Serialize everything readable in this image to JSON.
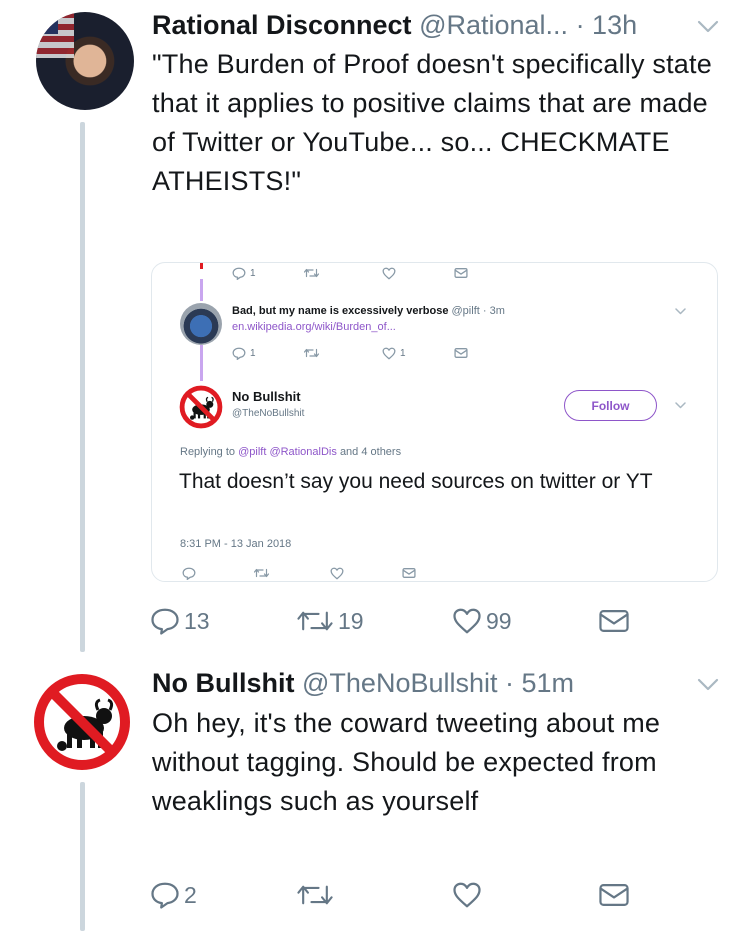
{
  "tweet1": {
    "name": "Rational Disconnect",
    "handle": "@Rational...",
    "time": "· 13h",
    "text": "\"The Burden of Proof doesn't specifically state that it applies to positive claims that are made of Twitter or YouTube... so... CHECKMATE ATHEISTS!\"",
    "replies": "13",
    "retweets": "19",
    "likes": "99"
  },
  "embed": {
    "top_actions": {
      "replies": "1"
    },
    "reply_tweet": {
      "name": "Bad, but my name is excessively verbose",
      "handle": "@pilft",
      "time": "· 3m",
      "link": "en.wikipedia.org/wiki/Burden_of...",
      "replies": "1",
      "likes": "1"
    },
    "main_tweet": {
      "name": "No Bullshit",
      "handle": "@TheNoBullshit",
      "follow_label": "Follow",
      "replying_prefix": "Replying to",
      "replying_mentions": "@pilft @RationalDis",
      "replying_suffix": "and 4 others",
      "text": "That doesn’t say you need sources on twitter or YT",
      "timestamp": "8:31 PM - 13 Jan 2018"
    }
  },
  "tweet2": {
    "name": "No Bullshit",
    "handle": "@TheNoBullshit",
    "time": "· 51m",
    "text": "Oh hey, it's the coward tweeting about me without tagging. Should be expected from weaklings such as yourself",
    "replies": "2"
  },
  "colors": {
    "text": "#14171a",
    "secondary": "#657786",
    "thread_line": "#ccd6dd",
    "accent_purple": "#8e56c9",
    "no_sign_red": "#e01b22"
  },
  "icons": [
    "reply-icon",
    "retweet-icon",
    "like-icon",
    "dm-icon",
    "chevron-down-icon",
    "no-sign-bull-icon"
  ]
}
